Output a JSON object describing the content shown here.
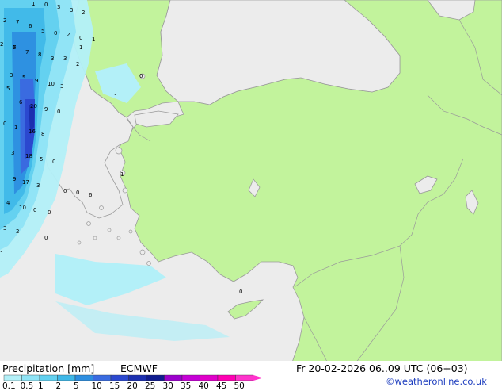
{
  "legend": {
    "title": "Precipitation [mm]",
    "model": "ECMWF",
    "ticks": [
      "0.1",
      "0.5",
      "1",
      "2",
      "5",
      "10",
      "15",
      "20",
      "25",
      "30",
      "35",
      "40",
      "45",
      "50"
    ],
    "colors": [
      "#b3f0f8",
      "#8fe3f5",
      "#62d0ef",
      "#3fb8e8",
      "#2d8ee0",
      "#3a6be0",
      "#2b48cf",
      "#1b2fb0",
      "#101c8f",
      "#9b00cc",
      "#c500d6",
      "#e000c9",
      "#ff00b3",
      "#ff33cc"
    ]
  },
  "valid_time": "Fr 20-02-2026 06..09 UTC (06+03)",
  "credit": "©weatheronline.co.uk",
  "colors": {
    "sea": "#ececec",
    "land_green": "#c2f39c",
    "land_grey": "#ececec",
    "border": "#9a9a9a"
  },
  "map_values": [
    "1",
    "0",
    "3",
    "3",
    "2",
    "2",
    "7",
    "6",
    "5",
    "0",
    "2",
    "1",
    "0",
    "7",
    "2",
    "1",
    "6",
    "7",
    "8",
    "3",
    "3",
    "2",
    "3",
    "5",
    "9",
    "10",
    "3",
    "5",
    "1",
    "6",
    "20",
    "9",
    "0",
    "16",
    "0",
    "1",
    "8",
    "3",
    "18",
    "0",
    "5",
    "17",
    "3",
    "0",
    "0",
    "6",
    "4",
    "10",
    "0",
    "0",
    "3",
    "2",
    "9",
    "1",
    "0",
    "1",
    "0",
    "0"
  ]
}
